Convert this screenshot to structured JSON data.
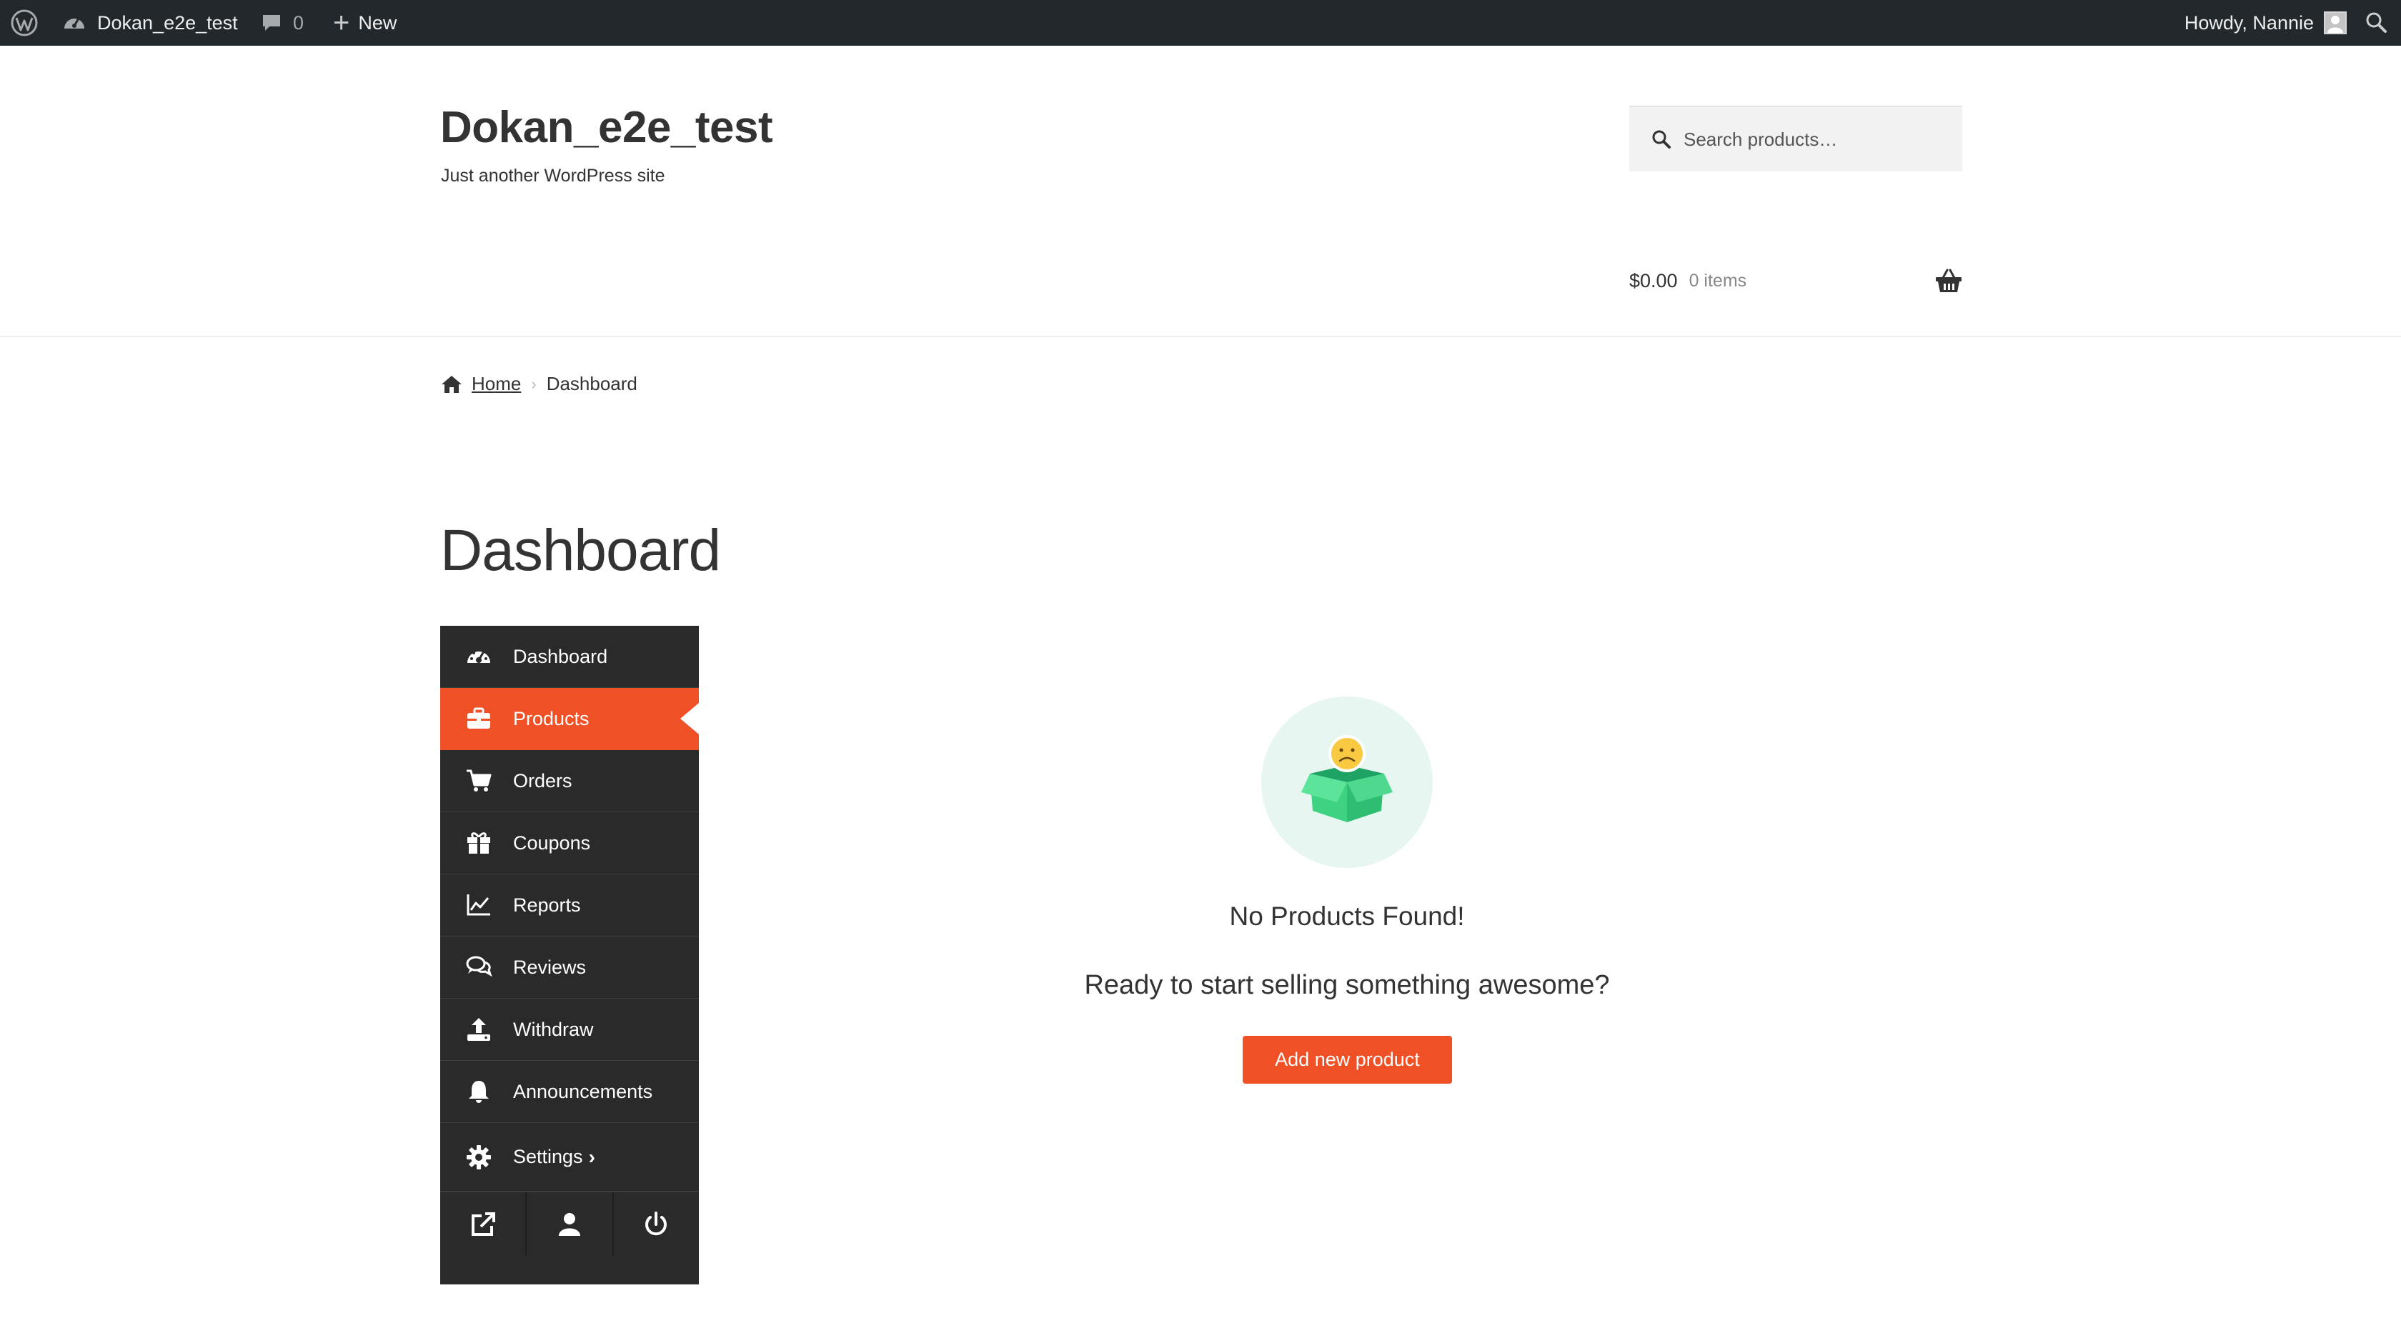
{
  "admin_bar": {
    "site_name": "Dokan_e2e_test",
    "comments_count": "0",
    "new_label": "New",
    "howdy": "Howdy, Nannie"
  },
  "header": {
    "site_title": "Dokan_e2e_test",
    "tagline": "Just another WordPress site",
    "search_placeholder": "Search products…",
    "cart_amount": "$0.00",
    "cart_count": "0 items"
  },
  "breadcrumb": {
    "home": "Home",
    "separator": "›",
    "current": "Dashboard"
  },
  "page_title": "Dashboard",
  "dashboard_nav": {
    "items": [
      {
        "label": "Dashboard",
        "icon": "tachometer-icon"
      },
      {
        "label": "Products",
        "icon": "briefcase-icon",
        "active": true
      },
      {
        "label": "Orders",
        "icon": "cart-icon"
      },
      {
        "label": "Coupons",
        "icon": "gift-icon"
      },
      {
        "label": "Reports",
        "icon": "line-chart-icon"
      },
      {
        "label": "Reviews",
        "icon": "comments-icon"
      },
      {
        "label": "Withdraw",
        "icon": "upload-icon"
      },
      {
        "label": "Announcements",
        "icon": "bell-icon"
      },
      {
        "label": "Settings",
        "icon": "gear-icon",
        "chevron": "›"
      }
    ],
    "bottom_icons": [
      "external-link-icon",
      "user-icon",
      "power-icon"
    ]
  },
  "empty_state": {
    "icon": "sad-box-icon",
    "title": "No Products Found!",
    "subtitle": "Ready to start selling something awesome?",
    "button_label": "Add new product"
  },
  "colors": {
    "admin_bar": "#23282d",
    "accent": "#f05025",
    "sidebar": "#2a2a2a",
    "empty_circle": "#e7f6f0"
  }
}
